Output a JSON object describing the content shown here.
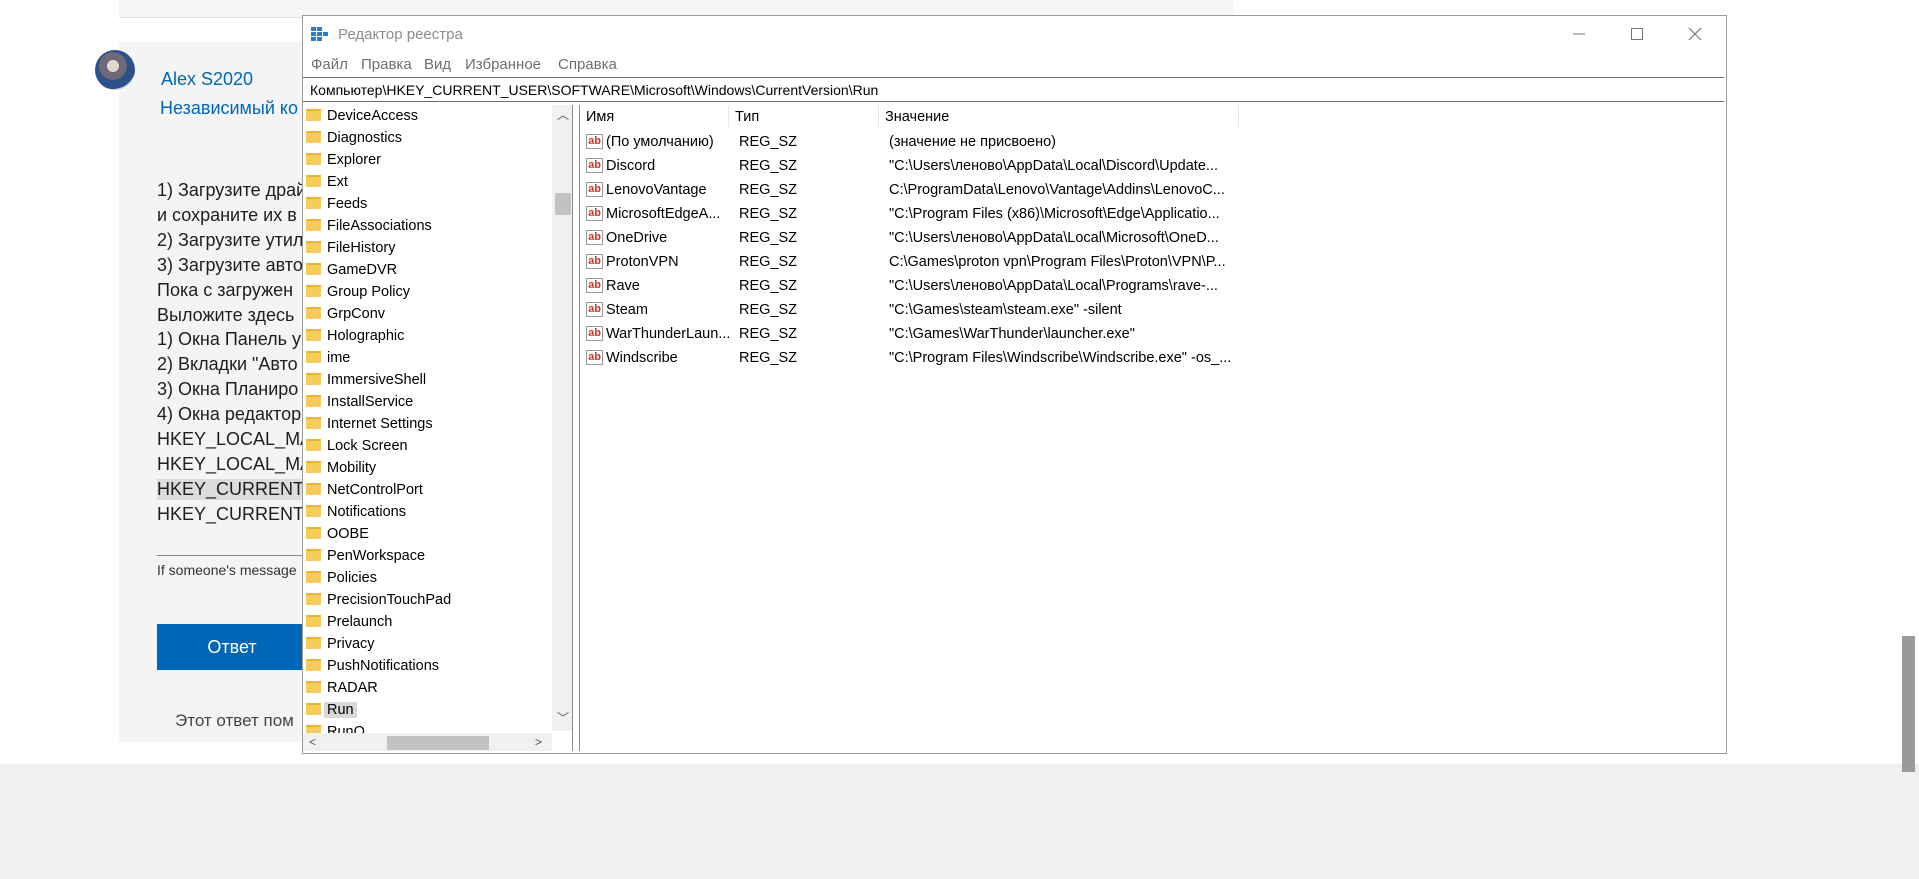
{
  "forum": {
    "author_name": "Alex S2020",
    "author_role": "Независимый ко",
    "post_lines": [
      "1) Загрузите драй",
      "и сохраните их в",
      "2) Загрузите утил",
      "3) Загрузите авто",
      "Пока с загружен",
      "Выложите здесь",
      "1) Окна Панель у",
      "2) Вкладки \"Авто",
      "3) Окна Планиро",
      "4) Окна редактор",
      "HKEY_LOCAL_MA",
      "HKEY_LOCAL_MA",
      "HKEY_CURRENT_",
      "HKEY_CURRENT_"
    ],
    "signature": "If someone's message",
    "reply_label": "Ответ",
    "helpful_text": "Этот ответ пом"
  },
  "regedit": {
    "title": "Редактор реестра",
    "menu": [
      "Файл",
      "Правка",
      "Вид",
      "Избранное",
      "Справка"
    ],
    "address": "Компьютер\\HKEY_CURRENT_USER\\SOFTWARE\\Microsoft\\Windows\\CurrentVersion\\Run",
    "tree": [
      "DeviceAccess",
      "Diagnostics",
      "Explorer",
      "Ext",
      "Feeds",
      "FileAssociations",
      "FileHistory",
      "GameDVR",
      "Group Policy",
      "GrpConv",
      "Holographic",
      "ime",
      "ImmersiveShell",
      "InstallService",
      "Internet Settings",
      "Lock Screen",
      "Mobility",
      "NetControlPort",
      "Notifications",
      "OOBE",
      "PenWorkspace",
      "Policies",
      "PrecisionTouchPad",
      "Prelaunch",
      "Privacy",
      "PushNotifications",
      "RADAR",
      "Run",
      "RunO"
    ],
    "selected_tree_item": "Run",
    "columns": [
      "Имя",
      "Тип",
      "Значение"
    ],
    "values": [
      {
        "name": "(По умолчанию)",
        "type": "REG_SZ",
        "data": "(значение не присвоено)"
      },
      {
        "name": "Discord",
        "type": "REG_SZ",
        "data": "\"C:\\Users\\леново\\AppData\\Local\\Discord\\Update..."
      },
      {
        "name": "LenovoVantage",
        "type": "REG_SZ",
        "data": "C:\\ProgramData\\Lenovo\\Vantage\\Addins\\LenovoC..."
      },
      {
        "name": "MicrosoftEdgeA...",
        "type": "REG_SZ",
        "data": "\"C:\\Program Files (x86)\\Microsoft\\Edge\\Applicatio..."
      },
      {
        "name": "OneDrive",
        "type": "REG_SZ",
        "data": "\"C:\\Users\\леново\\AppData\\Local\\Microsoft\\OneD..."
      },
      {
        "name": "ProtonVPN",
        "type": "REG_SZ",
        "data": "C:\\Games\\proton vpn\\Program Files\\Proton\\VPN\\P..."
      },
      {
        "name": "Rave",
        "type": "REG_SZ",
        "data": "\"C:\\Users\\леново\\AppData\\Local\\Programs\\rave-..."
      },
      {
        "name": "Steam",
        "type": "REG_SZ",
        "data": "\"C:\\Games\\steam\\steam.exe\" -silent"
      },
      {
        "name": "WarThunderLaun...",
        "type": "REG_SZ",
        "data": "\"C:\\Games\\WarThunder\\launcher.exe\""
      },
      {
        "name": "Windscribe",
        "type": "REG_SZ",
        "data": "\"C:\\Program Files\\Windscribe\\Windscribe.exe\" -os_..."
      }
    ],
    "icons": {
      "app": "registry-editor-icon",
      "folder": "folder-icon",
      "string_value": "string-value-icon",
      "minimize": "minimize-icon",
      "maximize": "maximize-icon",
      "close": "close-icon"
    },
    "colors": {
      "folder": "#f6cc5a",
      "ab_icon": "#d0312d",
      "selection": "#d9d9d9",
      "link": "#0067b8"
    }
  }
}
